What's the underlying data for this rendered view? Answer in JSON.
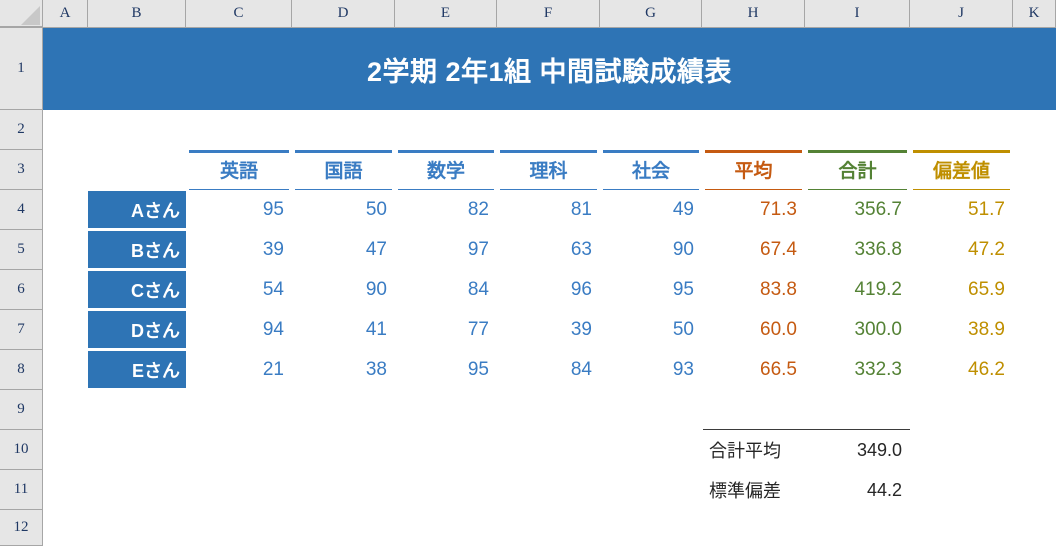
{
  "colors": {
    "accent_blue": "#2E74B5",
    "subject_text": "#3a7cc3",
    "average_orange": "#C55A11",
    "total_green": "#548235",
    "deviation_gold": "#BF8F00",
    "header_grey": "#E6E6E6",
    "gridline": "#A6A6A6",
    "summary_text": "#262626"
  },
  "grid": {
    "column_headers": [
      "A",
      "B",
      "C",
      "D",
      "E",
      "F",
      "G",
      "H",
      "I",
      "J",
      "K"
    ],
    "row_headers": [
      "1",
      "2",
      "3",
      "4",
      "5",
      "6",
      "7",
      "8",
      "9",
      "10",
      "11",
      "12"
    ]
  },
  "title": {
    "text": "2学期 2年1組 中間試験成績表"
  },
  "table": {
    "columns": [
      {
        "label": "英語",
        "color": "#3a7cc3",
        "align": "center"
      },
      {
        "label": "国語",
        "color": "#3a7cc3",
        "align": "center"
      },
      {
        "label": "数学",
        "color": "#3a7cc3",
        "align": "center"
      },
      {
        "label": "理科",
        "color": "#3a7cc3",
        "align": "center"
      },
      {
        "label": "社会",
        "color": "#3a7cc3",
        "align": "center"
      },
      {
        "label": "平均",
        "color": "#C55A11",
        "align": "center"
      },
      {
        "label": "合計",
        "color": "#548235",
        "align": "center"
      },
      {
        "label": "偏差値",
        "color": "#BF8F00",
        "align": "center"
      }
    ],
    "rows": [
      {
        "name": "Aさん",
        "english": "95",
        "japanese": "50",
        "math": "82",
        "science": "81",
        "social": "49",
        "average": "71.3",
        "total": "356.7",
        "deviation": "51.7"
      },
      {
        "name": "Bさん",
        "english": "39",
        "japanese": "47",
        "math": "97",
        "science": "63",
        "social": "90",
        "average": "67.4",
        "total": "336.8",
        "deviation": "47.2"
      },
      {
        "name": "Cさん",
        "english": "54",
        "japanese": "90",
        "math": "84",
        "science": "96",
        "social": "95",
        "average": "83.8",
        "total": "419.2",
        "deviation": "65.9"
      },
      {
        "name": "Dさん",
        "english": "94",
        "japanese": "41",
        "math": "77",
        "science": "39",
        "social": "50",
        "average": "60.0",
        "total": "300.0",
        "deviation": "38.9"
      },
      {
        "name": "Eさん",
        "english": "21",
        "japanese": "38",
        "math": "95",
        "science": "84",
        "social": "93",
        "average": "66.5",
        "total": "332.3",
        "deviation": "46.2"
      }
    ]
  },
  "summary": {
    "items": [
      {
        "label": "合計平均",
        "value": "349.0"
      },
      {
        "label": "標準偏差",
        "value": "44.2"
      }
    ]
  }
}
